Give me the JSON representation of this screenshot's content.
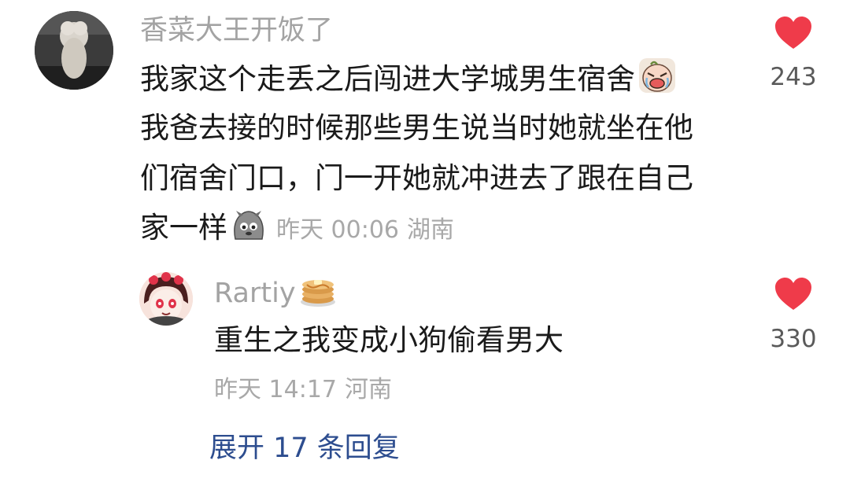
{
  "comment": {
    "username": "香菜大王开饭了",
    "lines": [
      "我家这个走丢之后闯进大学城男生宿舍",
      "我爸去接的时候那些男生说当时她就坐在他",
      "们宿舍门口，门一开她就冲进去了跟在自己",
      "家一样"
    ],
    "time": "昨天 00:06",
    "location": "湖南",
    "likes": "243",
    "emojis": [
      "crying-face-emoji",
      "sad-dog-emoji"
    ]
  },
  "reply": {
    "username": "Rartiy",
    "username_badge": "pancake-emoji",
    "text": "重生之我变成小狗偷看男大",
    "time": "昨天 14:17",
    "location": "河南",
    "likes": "330"
  },
  "expand_replies": {
    "label": "展开 17 条回复"
  },
  "colors": {
    "heart": "#ef3b4a",
    "link": "#2d4d8f",
    "muted": "#a8a8a8",
    "text": "#1a1a1a"
  }
}
